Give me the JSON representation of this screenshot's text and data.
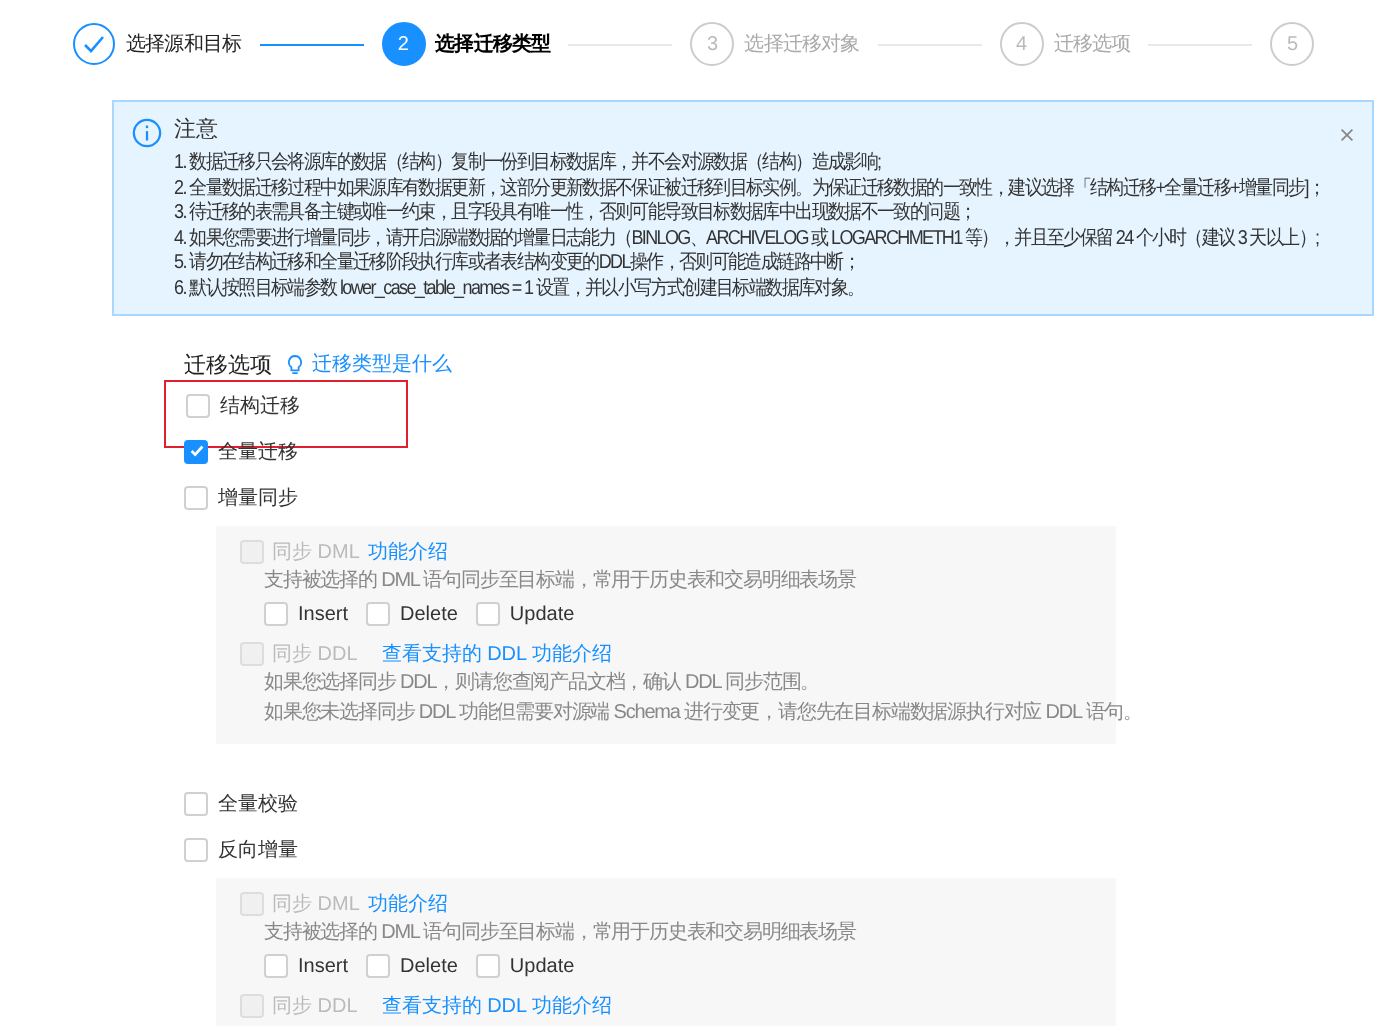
{
  "steps": [
    {
      "label": "选择源和目标",
      "completed": true,
      "selected": false
    },
    {
      "number": "2",
      "label": "选择迁移类型",
      "completed": false,
      "selected": true
    },
    {
      "number": "3",
      "label": "选择迁移对象",
      "completed": false,
      "selected": false
    },
    {
      "number": "4",
      "label": "迁移选项",
      "completed": false,
      "selected": false
    },
    {
      "number": "5",
      "completed": false,
      "selected": false
    }
  ],
  "alert": {
    "title": "注意",
    "lines": [
      "1. 数据迁移只会将源库的数据（结构）复制一份到目标数据库，并不会对源数据（结构）造成影响;",
      "2. 全量数据迁移过程中如果源库有数据更新，这部分更新数据不保证被迁移到目标实例。为保证迁移数据的一致性，建议选择「结构迁移+全量迁移+增量同步]；",
      "3. 待迁移的表需具备主键或唯一约束，且字段具有唯一性，否则可能导致目标数据库中出现数据不一致的问题；",
      "4. 如果您需要进行增量同步，请开启源端数据的增量日志能力（BINLOG、ARCHIVELOG 或 LOGARCHMETH1 等），并且至少保留 24 个小时（建议 3 天以上）;",
      "5. 请勿在结构迁移和全量迁移阶段执行库或者表结构变更的DDL操作，否则可能造成链路中断；",
      "6. 默认按照目标端参数 lower_case_table_names = 1 设置，并以小写方式创建目标端数据库对象。"
    ]
  },
  "options": {
    "title": "迁移选项",
    "help_link": "迁移类型是什么",
    "items": [
      {
        "label": "结构迁移",
        "checked": false,
        "highlighted": true
      },
      {
        "label": "全量迁移",
        "checked": true,
        "highlighted": false
      },
      {
        "label": "增量同步",
        "checked": false,
        "highlighted": false,
        "panel": [
          {
            "kind": "dml",
            "label": "同步 DML",
            "link": "功能介绍",
            "checked": false,
            "disabled": true,
            "descriptions": [
              "支持被选择的 DML 语句同步至目标端，常用于历史表和交易明细表场景"
            ],
            "ops": [
              {
                "label": "Insert",
                "checked": false
              },
              {
                "label": "Delete",
                "checked": false
              },
              {
                "label": "Update",
                "checked": false
              }
            ]
          },
          {
            "kind": "ddl",
            "label": "同步 DDL",
            "link": "查看支持的 DDL  功能介绍",
            "checked": false,
            "disabled": true,
            "descriptions": [
              "如果您选择同步 DDL，则请您查阅产品文档，确认 DDL 同步范围。",
              "如果您未选择同步 DDL 功能但需要对源端 Schema 进行变更，请您先在目标端数据源执行对应 DDL 语句。"
            ]
          }
        ]
      },
      {
        "label": "全量校验",
        "checked": false,
        "highlighted": false
      },
      {
        "label": "反向增量",
        "checked": false,
        "highlighted": false,
        "panel": [
          {
            "kind": "dml",
            "label": "同步 DML",
            "link": "功能介绍",
            "checked": false,
            "disabled": true,
            "descriptions": [
              "支持被选择的 DML 语句同步至目标端，常用于历史表和交易明细表场景"
            ],
            "ops": [
              {
                "label": "Insert",
                "checked": false
              },
              {
                "label": "Delete",
                "checked": false
              },
              {
                "label": "Update",
                "checked": false
              }
            ]
          },
          {
            "kind": "ddl",
            "label": "同步 DDL",
            "link": "查看支持的 DDL  功能介绍",
            "checked": false,
            "disabled": true
          }
        ]
      }
    ]
  }
}
